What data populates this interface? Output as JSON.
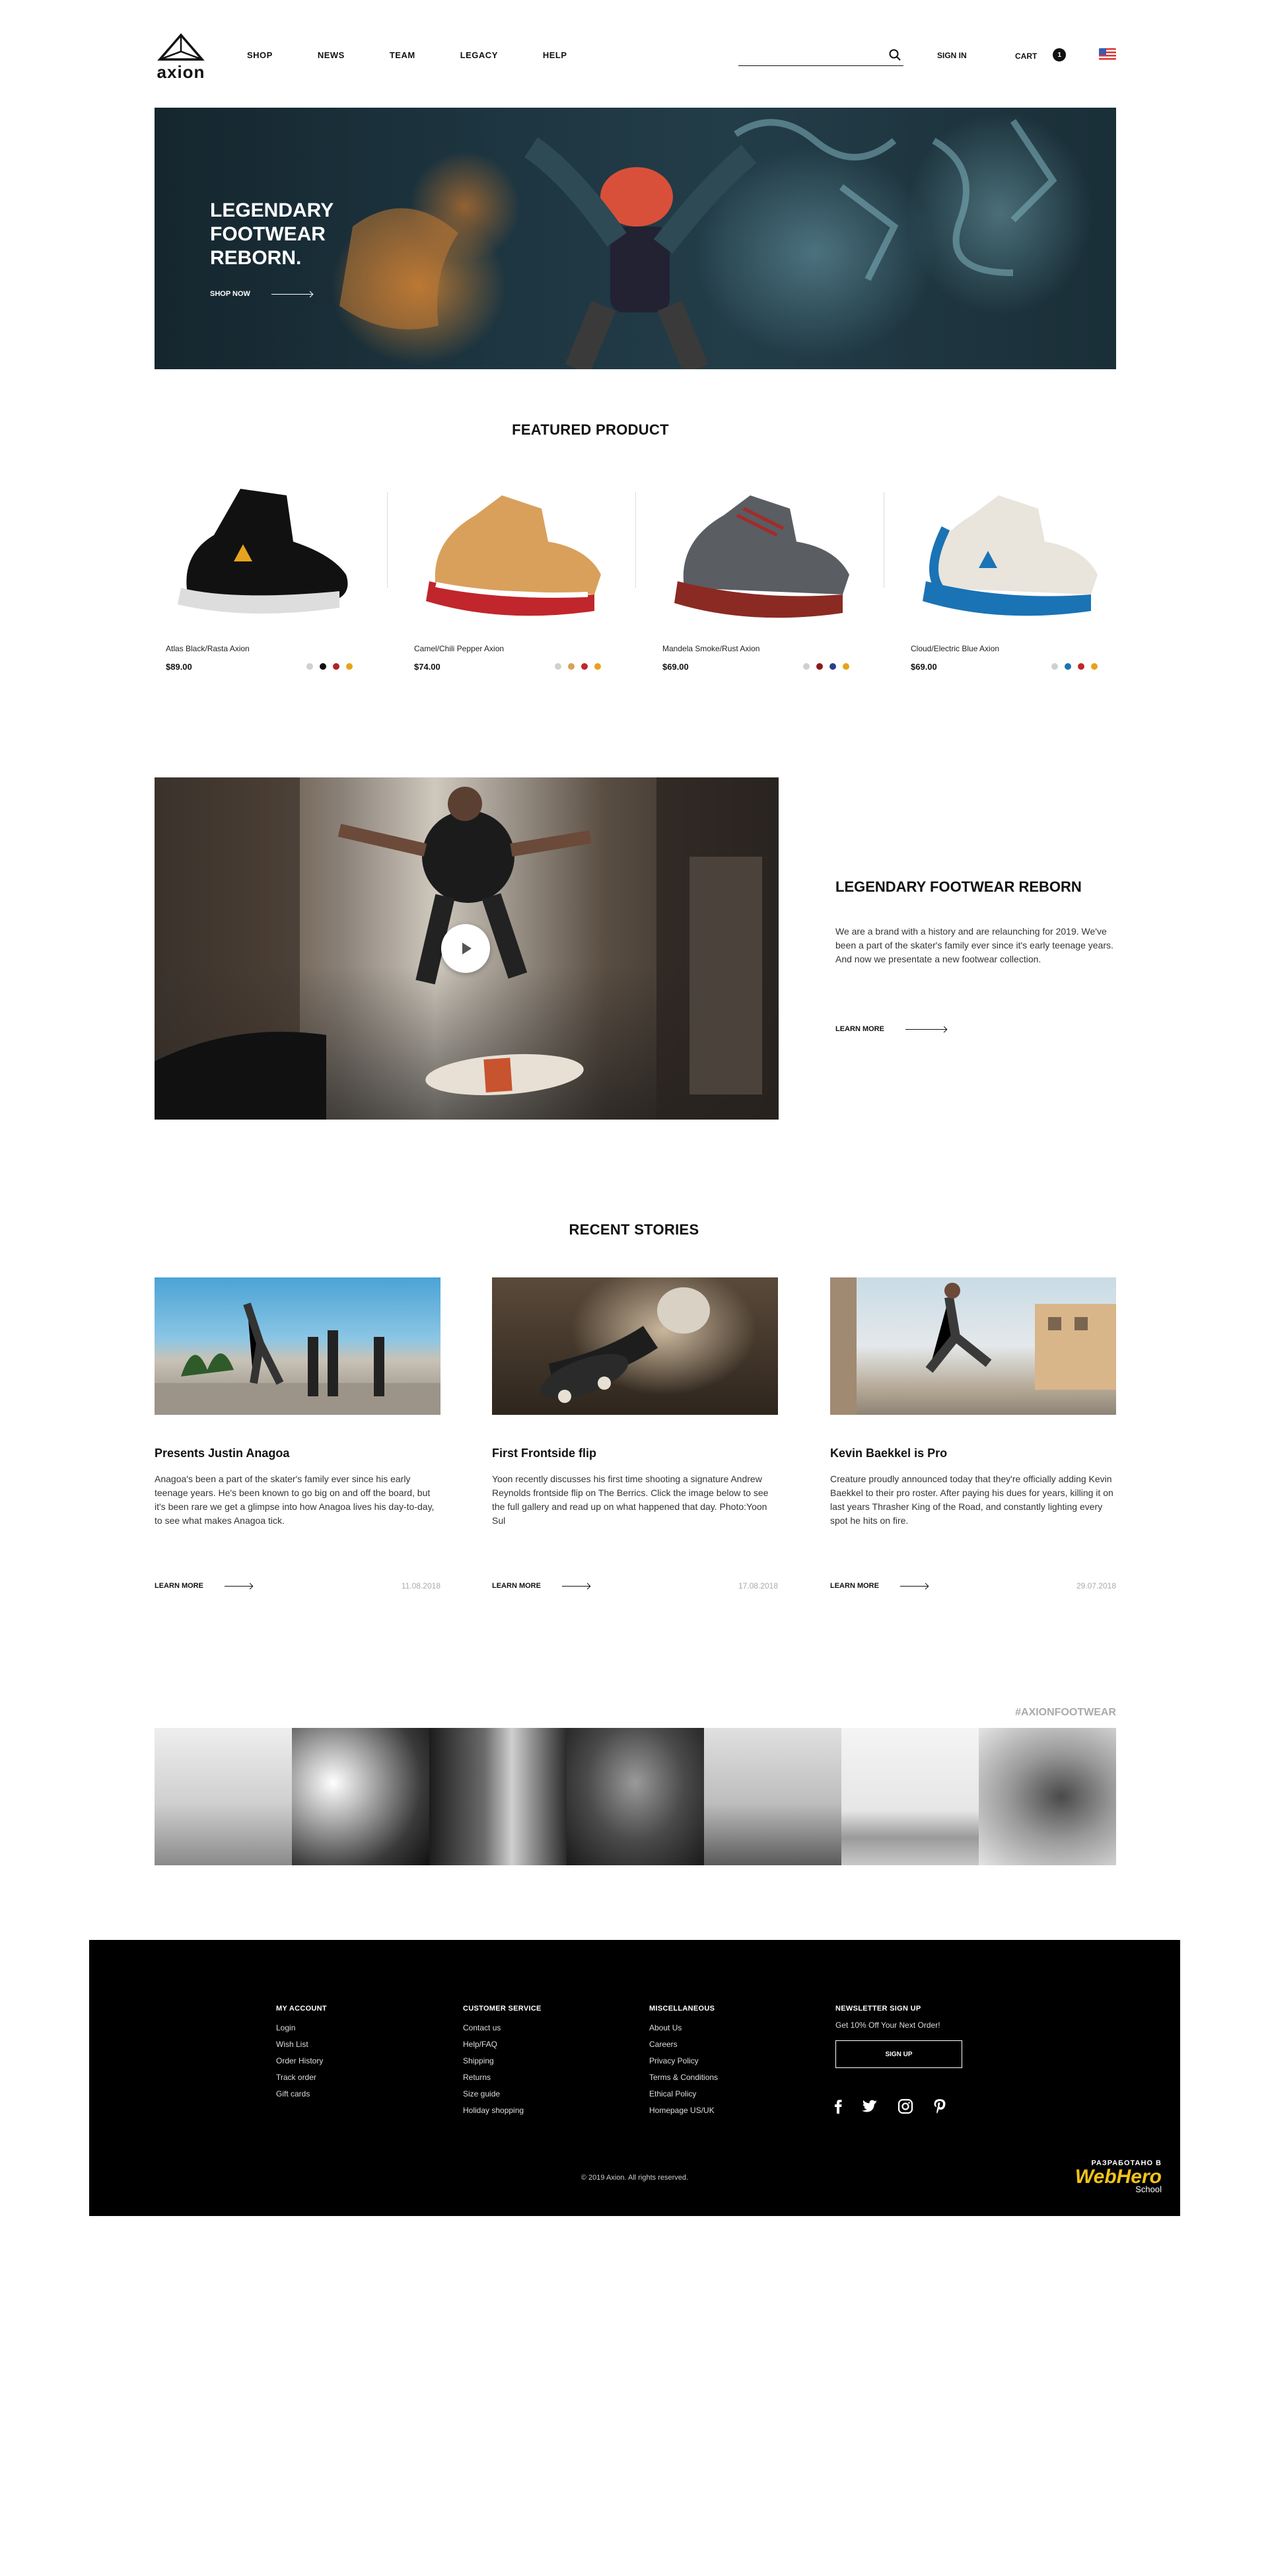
{
  "header": {
    "logo_text": "axion",
    "nav": [
      "SHOP",
      "NEWS",
      "TEAM",
      "LEGACY",
      "HELP"
    ],
    "search_placeholder": "",
    "sign_in": "SIGN IN",
    "cart_label": "CART",
    "cart_count": "1",
    "flag": "us-flag-icon"
  },
  "hero": {
    "title": "LEGENDARY FOOTWEAR REBORN.",
    "cta": "SHOP NOW"
  },
  "featured": {
    "title": "FEATURED PRODUCT",
    "products": [
      {
        "name": "Atlas Black/Rasta Axion",
        "price": "$89.00",
        "swatches": [
          "#d0d0d0",
          "#111111",
          "#b22222",
          "#e8a317"
        ]
      },
      {
        "name": "Camel/Chili Pepper Axion",
        "price": "$74.00",
        "swatches": [
          "#d0d0d0",
          "#d9a05b",
          "#c0262c",
          "#e8a317"
        ]
      },
      {
        "name": "Mandela Smoke/Rust Axion",
        "price": "$69.00",
        "swatches": [
          "#d0d0d0",
          "#8b1a1a",
          "#2b3d8f",
          "#e8a317"
        ]
      },
      {
        "name": "Cloud/Electric Blue Axion",
        "price": "$69.00",
        "swatches": [
          "#d0d0d0",
          "#1a73b5",
          "#c0262c",
          "#e8a317"
        ]
      }
    ]
  },
  "about": {
    "title": "LEGENDARY FOOTWEAR REBORN",
    "text": "We are a brand with a history and are relaunching for 2019. We've been a part of the skater's family ever since it's early teenage years. And now we presentate a new footwear collection.",
    "cta": "LEARN MORE"
  },
  "stories": {
    "title": "RECENT STORIES",
    "items": [
      {
        "title": "Presents Justin Anagoa",
        "text": "Anagoa's been a part of the skater's family ever since his early teenage years. He's been known to go big on and off the board, but it's been rare we get a glimpse into how Anagoa lives his day-to-day, to see what makes Anagoa tick.",
        "cta": "LEARN MORE",
        "date": "11.08.2018"
      },
      {
        "title": "First Frontside flip",
        "text": "Yoon recently discusses his first time shooting a signature Andrew Reynolds frontside flip on The Berrics. Click the image below to see the full gallery and read up on what happened that day. Photo:Yoon Sul",
        "cta": "LEARN MORE",
        "date": "17.08.2018"
      },
      {
        "title": "Kevin Baekkel is Pro",
        "text": "Creature proudly announced today that they're officially adding Kevin Baekkel to their pro roster. After paying his dues for years, killing it on last years Thrasher King of the Road, and constantly lighting every spot he hits on fire.",
        "cta": "LEARN MORE",
        "date": "29.07.2018"
      }
    ]
  },
  "instagram": {
    "hashtag": "#AXIONFOOTWEAR"
  },
  "footer": {
    "columns": [
      {
        "title": "MY ACCOUNT",
        "links": [
          "Login",
          "Wish List",
          "Order History",
          "Track order",
          "Gift cards"
        ]
      },
      {
        "title": "CUSTOMER SERVICE",
        "links": [
          "Contact us",
          "Help/FAQ",
          "Shipping",
          "Returns",
          "Size guide",
          "Holiday shopping"
        ]
      },
      {
        "title": "MISCELLANEOUS",
        "links": [
          "About Us",
          "Careers",
          "Privacy Policy",
          "Terms & Conditions",
          "Ethical Policy",
          "Homepage US/UK"
        ]
      }
    ],
    "newsletter": {
      "title": "NEWSLETTER SIGN UP",
      "text": "Get 10% Off Your Next Order!",
      "button": "SIGN UP"
    },
    "social": [
      "facebook-icon",
      "twitter-icon",
      "instagram-icon",
      "pinterest-icon"
    ],
    "copyright": "© 2019 Axion. All rights reserved.",
    "credit": {
      "line1": "РАЗРАБОТАНО В",
      "brand": "WebHero",
      "line3": "School"
    }
  }
}
